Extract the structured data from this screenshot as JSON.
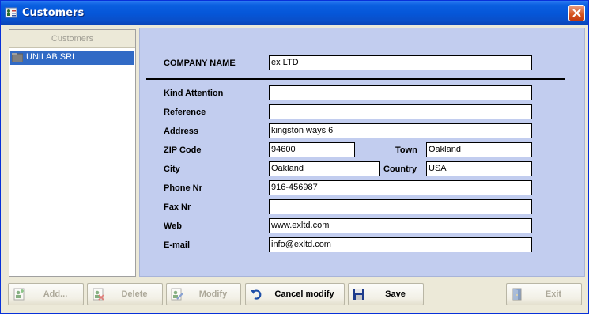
{
  "window": {
    "title": "Customers",
    "icons": {
      "app": "customers-icon",
      "close": "close-icon"
    }
  },
  "customer_list": {
    "header": "Customers",
    "items": [
      {
        "label": "UNILAB SRL",
        "selected": true,
        "icon": "folder-icon"
      }
    ]
  },
  "form": {
    "company_name": {
      "label": "COMPANY NAME",
      "value": "ex LTD"
    },
    "kind_attention": {
      "label": "Kind Attention",
      "value": ""
    },
    "reference": {
      "label": "Reference",
      "value": ""
    },
    "address": {
      "label": "Address",
      "value": "kingston ways 6"
    },
    "zip_code": {
      "label": "ZIP Code",
      "value": "94600"
    },
    "town": {
      "label": "Town",
      "value": "Oakland"
    },
    "city": {
      "label": "City",
      "value": "Oakland"
    },
    "country": {
      "label": "Country",
      "value": "USA"
    },
    "phone": {
      "label": "Phone Nr",
      "value": "916-456987"
    },
    "fax": {
      "label": "Fax Nr",
      "value": ""
    },
    "web": {
      "label": "Web",
      "value": "www.exltd.com"
    },
    "email": {
      "label": "E-mail",
      "value": "info@exltd.com"
    }
  },
  "toolbar": {
    "add": {
      "label": "Add...",
      "enabled": false,
      "icon": "add-user-icon"
    },
    "delete": {
      "label": "Delete",
      "enabled": false,
      "icon": "delete-user-icon"
    },
    "modify": {
      "label": "Modify",
      "enabled": false,
      "icon": "edit-icon"
    },
    "cancel_modify": {
      "label": "Cancel modify",
      "enabled": true,
      "icon": "undo-icon"
    },
    "save": {
      "label": "Save",
      "enabled": true,
      "icon": "floppy-disk-icon"
    },
    "exit": {
      "label": "Exit",
      "enabled": false,
      "icon": "exit-door-icon"
    }
  },
  "colors": {
    "title_bar": "#0556d8",
    "form_background": "#c2cdef",
    "selection": "#316ac5",
    "window_face": "#ece9d8"
  }
}
